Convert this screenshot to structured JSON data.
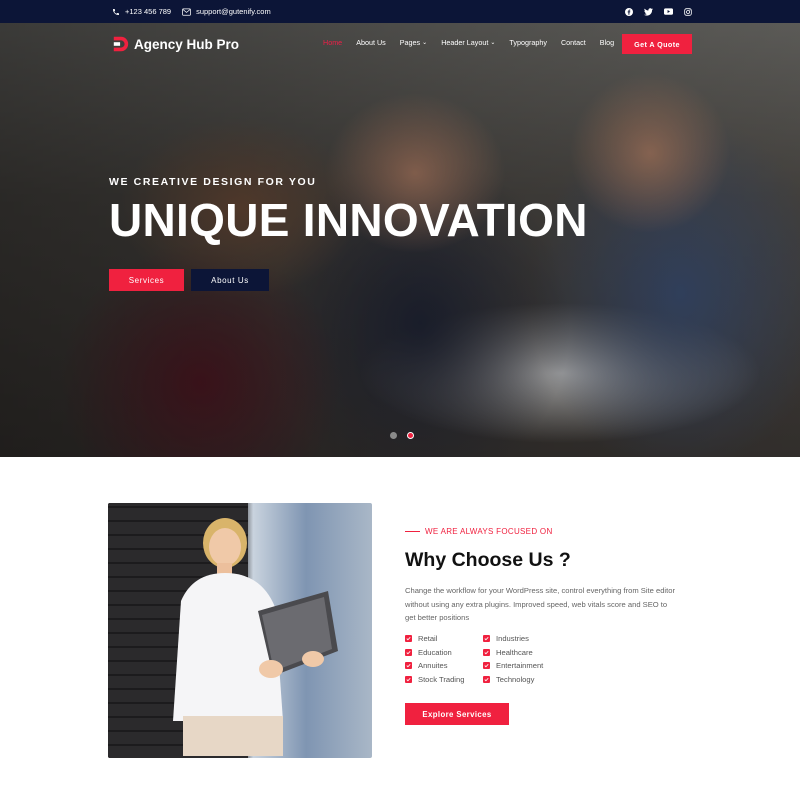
{
  "topbar": {
    "phone": "+123 456 789",
    "email": "support@gutenify.com",
    "social_icons": [
      "facebook-icon",
      "twitter-icon",
      "youtube-icon",
      "instagram-icon"
    ]
  },
  "nav": {
    "brand": "Agency Hub Pro",
    "items": [
      {
        "label": "Home",
        "active": true
      },
      {
        "label": "About Us"
      },
      {
        "label": "Pages",
        "dropdown": true
      },
      {
        "label": "Header Layout",
        "dropdown": true
      },
      {
        "label": "Typography"
      },
      {
        "label": "Contact"
      },
      {
        "label": "Blog"
      }
    ],
    "cta": "Get A Quote"
  },
  "hero": {
    "eyebrow": "WE CREATIVE DESIGN FOR YOU",
    "headline": "UNIQUE INNOVATION",
    "buttons": {
      "primary": "Services",
      "secondary": "About Us"
    },
    "slides": 2,
    "active_slide": 2
  },
  "why": {
    "kicker": "WE ARE ALWAYS FOCUSED ON",
    "title": "Why Choose Us ?",
    "description": "Change the workflow for your WordPress site, control everything from Site editor without using any extra plugins. Improved speed, web vitals score and SEO to get better positions",
    "features": [
      "Retail",
      "Industries",
      "Education",
      "Healthcare",
      "Annuites",
      "Entertainment",
      "Stock Trading",
      "Technology"
    ],
    "button": "Explore Services"
  },
  "colors": {
    "accent": "#f0213f",
    "navy": "#0c1537"
  }
}
